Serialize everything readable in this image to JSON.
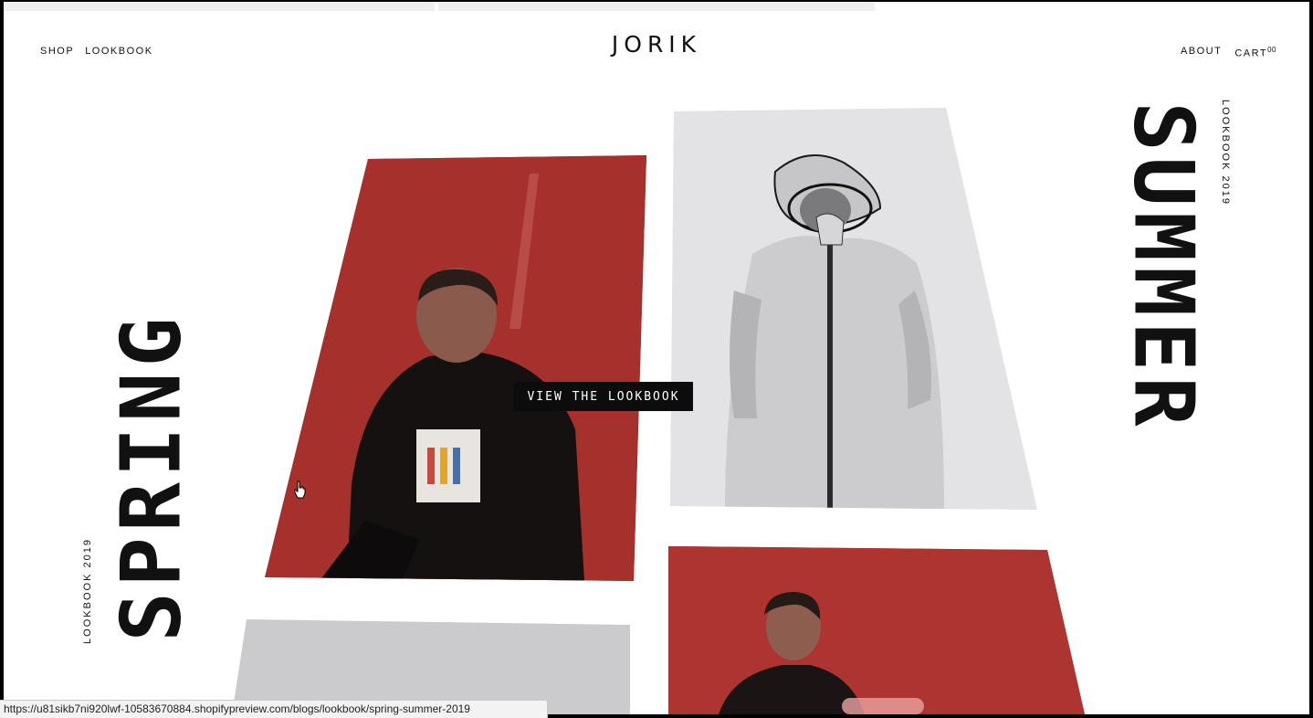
{
  "header": {
    "logo": "JORIK",
    "nav_left": [
      "SHOP",
      "LOOKBOOK"
    ],
    "nav_right": {
      "about": "ABOUT",
      "cart": "CART",
      "cart_count": "00"
    }
  },
  "hero": {
    "left_title": "SPRING",
    "left_subtitle": "LOOKBOOK 2019",
    "right_title": "SUMMER",
    "right_subtitle": "LOOKBOOK 2019",
    "cta_label": "VIEW THE LOOKBOOK"
  },
  "photos": [
    {
      "name": "photo-man-red-hoodie",
      "bg": "#a5302c"
    },
    {
      "name": "photo-woman-clear-raincoat",
      "bg": "#e3e3e5"
    },
    {
      "name": "photo-man-red-background",
      "bg": "#ad342f"
    },
    {
      "name": "photo-grey-partial",
      "bg": "#cbcbcd"
    }
  ],
  "status_bar": {
    "url": "https://u81sikb7ni920lwf-10583670884.shopifypreview.com/blogs/lookbook/spring-summer-2019"
  },
  "colors": {
    "text": "#111111",
    "button_bg": "#0c0c0c",
    "button_text": "#ffffff"
  },
  "icons": [
    "pointer-hand-icon"
  ]
}
